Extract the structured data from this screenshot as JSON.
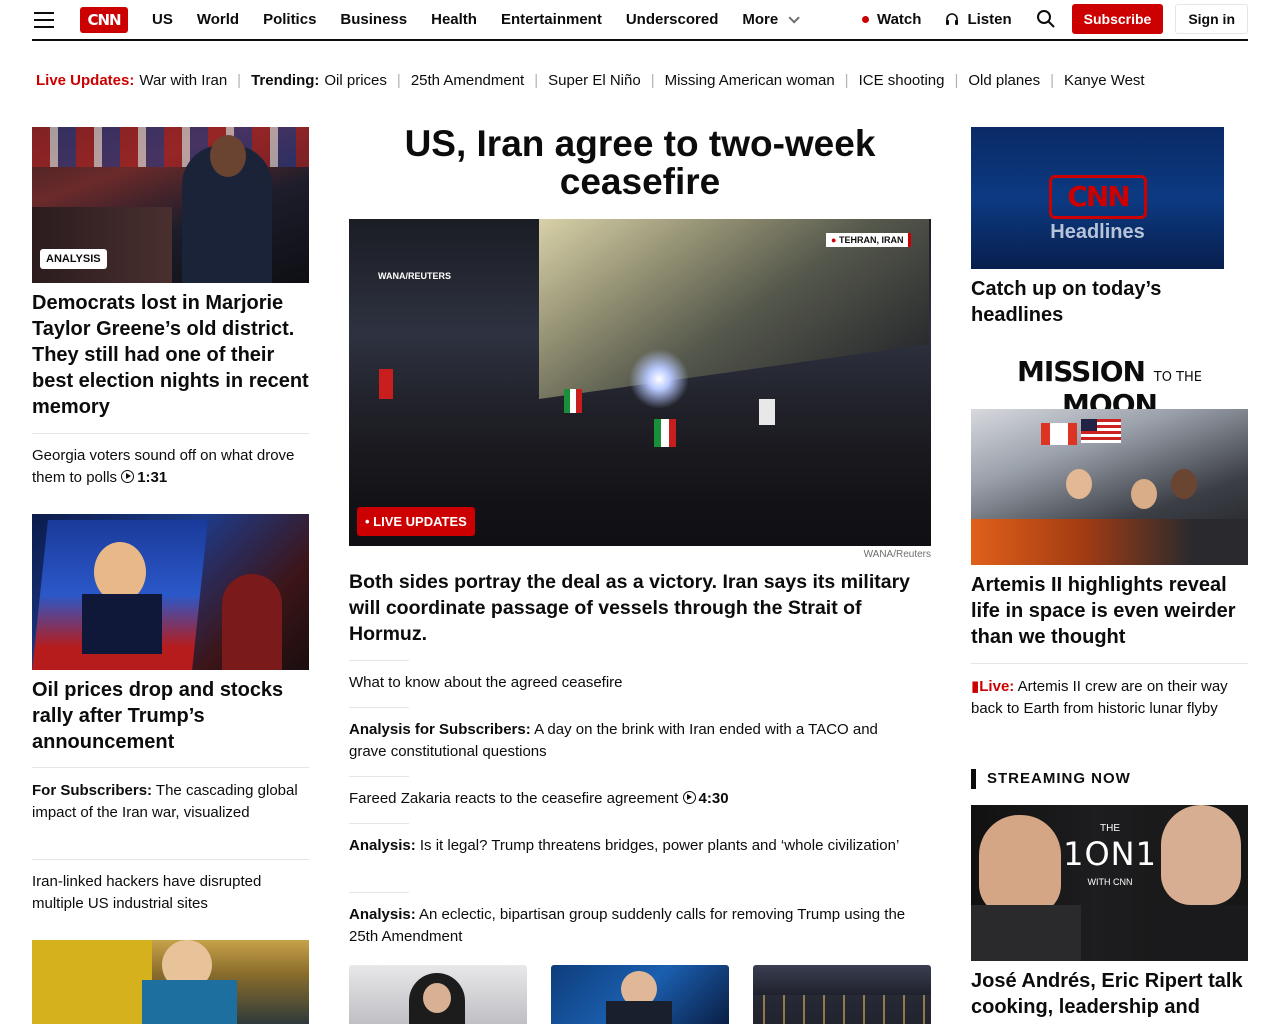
{
  "header": {
    "logo": "CNN",
    "nav": [
      "US",
      "World",
      "Politics",
      "Business",
      "Health",
      "Entertainment",
      "Underscored",
      "More"
    ],
    "watch": "Watch",
    "listen": "Listen",
    "subscribe": "Subscribe",
    "signin": "Sign in"
  },
  "trending": {
    "live_label": "Live Updates:",
    "live_link": "War with Iran",
    "trending_label": "Trending:",
    "items": [
      "Oil prices",
      "25th Amendment",
      "Super El Niño",
      "Missing American woman",
      "ICE shooting",
      "Old planes",
      "Kanye West"
    ]
  },
  "left": {
    "badge": "ANALYSIS",
    "headline1": "Democrats lost in Marjorie Taylor Greene’s old district. They still had one of their best election nights in recent memory",
    "link1": "Georgia voters sound off on what drove them to polls",
    "link1_duration": "1:31",
    "headline2": "Oil prices drop and stocks rally after Trump’s announcement",
    "link2_label": "For Subscribers:",
    "link2_text": " The cascading global impact of the Iran war, visualized",
    "link3": "Iran-linked hackers have disrupted multiple US industrial sites"
  },
  "center": {
    "headline": "US, Iran agree to two-week ceasefire",
    "location": "TEHRAN, IRAN",
    "wana": "WANA/REUTERS",
    "live_badge": "• LIVE UPDATES",
    "credit": "WANA/Reuters",
    "subhead": "Both sides portray the deal as a victory. Iran says its military will coordinate passage of vessels through the Strait of Hormuz.",
    "link1": "What to know about the agreed ceasefire",
    "link2_label": "Analysis for Subscribers:",
    "link2_text": " A day on the brink with Iran ended with a TACO and grave constitutional questions",
    "link3": "Fareed Zakaria reacts to the ceasefire agreement",
    "link3_duration": "4:30",
    "link4_label": "Analysis:",
    "link4_text": " Is it legal? Trump threatens bridges, power plants and ‘whole civilization’",
    "link5_label": "Analysis:",
    "link5_text": " An eclectic, bipartisan group suddenly calls for removing Trump using the 25th Amendment"
  },
  "right": {
    "video_logo": "CNN",
    "video_title": "Headlines",
    "headline1": "Catch up on today’s headlines",
    "mission_big1": "MISSION",
    "mission_small": "TO THE",
    "mission_big2": "MOON",
    "headline2": "Artemis II highlights reveal life in space is even weirder than we thought",
    "live_label": "Live:",
    "live_text": " Artemis II crew are on their way back to Earth from historic lunar flyby",
    "streaming": "STREAMING NOW",
    "show_the": "THE",
    "show_title": "1ON1",
    "show_with": "WITH CNN",
    "headline3": "José Andrés, Eric Ripert talk cooking, leadership and"
  }
}
